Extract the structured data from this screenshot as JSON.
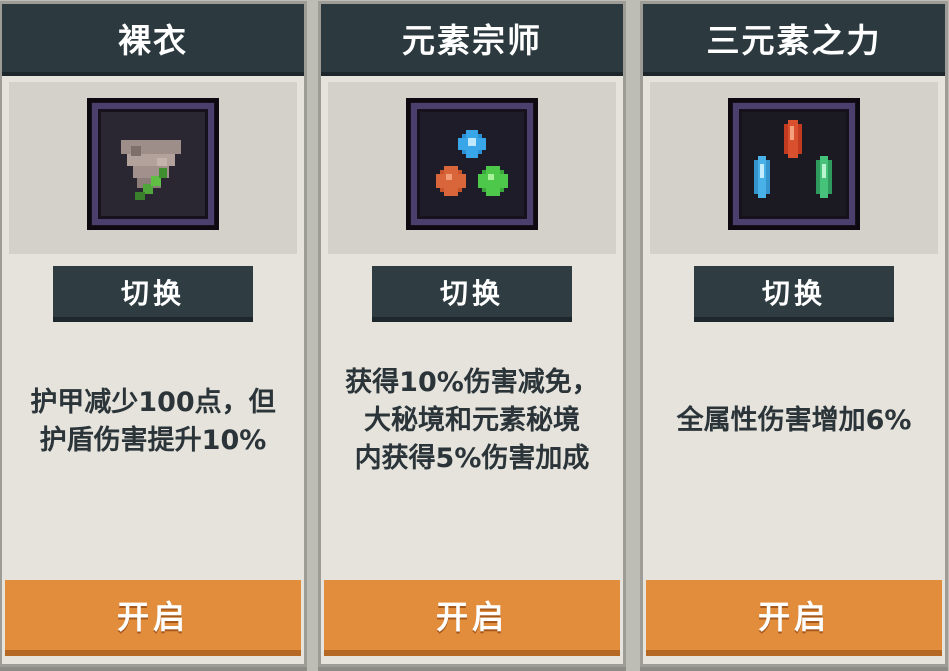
{
  "cards": [
    {
      "title": "裸衣",
      "icon": "tattered-cloth-icon",
      "switch_label": "切换",
      "description": "护甲减少100点，但\n护盾伤害提升10%",
      "open_label": "开启"
    },
    {
      "title": "元素宗师",
      "icon": "element-orbs-icon",
      "switch_label": "切换",
      "description": "获得10%伤害减免，\n大秘境和元素秘境\n内获得5%伤害加成",
      "open_label": "开启"
    },
    {
      "title": "三元素之力",
      "icon": "three-element-crystals-icon",
      "switch_label": "切换",
      "description": "全属性伤害增加6%",
      "open_label": "开启"
    }
  ],
  "colors": {
    "header": "#2c3a40",
    "card": "#e5e3dc",
    "open_button": "#e18d3c",
    "switch_button": "#2f3d43",
    "icon_frame_border": "#4b3f6e"
  }
}
